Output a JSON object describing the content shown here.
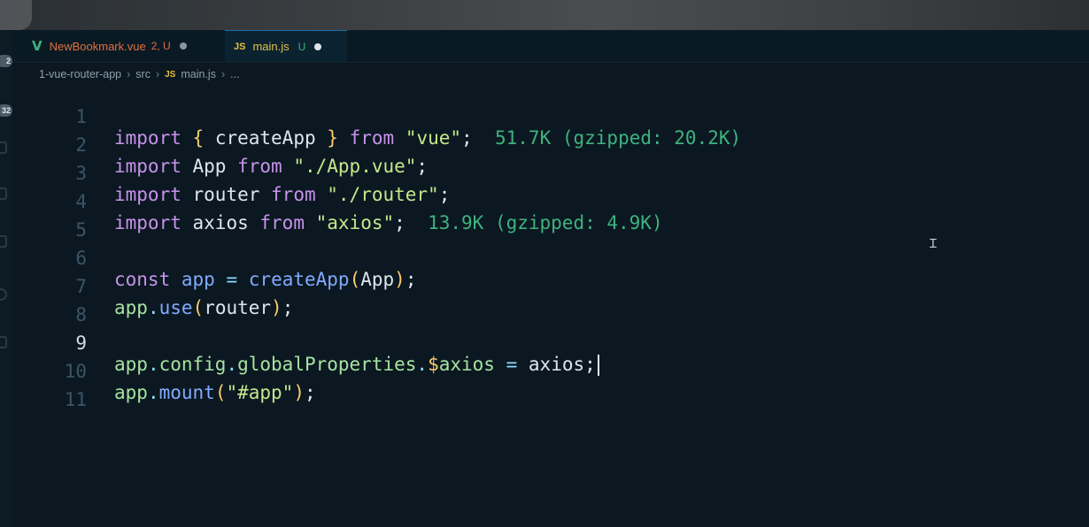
{
  "activity_bar": {
    "badges": [
      "2",
      "32"
    ]
  },
  "tabs": [
    {
      "filename": "NewBookmark.vue",
      "status": "2, U",
      "icon": "vue-icon",
      "icon_text": "V"
    },
    {
      "filename": "main.js",
      "status": "U",
      "icon": "js-icon",
      "icon_text": "JS"
    }
  ],
  "breadcrumb": {
    "segments": [
      "1-vue-router-app",
      "src",
      "main.js",
      "..."
    ],
    "file_icon_text": "JS"
  },
  "editor": {
    "active_line": 9,
    "line_numbers": [
      "1",
      "2",
      "3",
      "4",
      "5",
      "6",
      "7",
      "8",
      "9",
      "10",
      "11"
    ],
    "lines": [
      {
        "import_kw": "import",
        "brace_open": "{",
        "name": "createApp",
        "brace_close": "}",
        "from_kw": "from",
        "module": "\"vue\"",
        "semi": ";",
        "size_hint": "51.7K (gzipped: 20.2K)"
      },
      {
        "import_kw": "import",
        "name": "App",
        "from_kw": "from",
        "module": "\"./App.vue\"",
        "semi": ";"
      },
      {
        "import_kw": "import",
        "name": "router",
        "from_kw": "from",
        "module": "\"./router\"",
        "semi": ";"
      },
      {
        "import_kw": "import",
        "name": "axios",
        "from_kw": "from",
        "module": "\"axios\"",
        "semi": ";",
        "size_hint": "13.9K (gzipped: 4.9K)"
      },
      {},
      {
        "const_kw": "const",
        "var": "app",
        "eq": "=",
        "fn": "createApp",
        "paren_open": "(",
        "arg": "App",
        "paren_close": ")",
        "semi": ";"
      },
      {
        "obj": "app",
        "dot": ".",
        "fn": "use",
        "paren_open": "(",
        "arg": "router",
        "paren_close": ")",
        "semi": ";"
      },
      {},
      {
        "obj": "app",
        "dot1": ".",
        "p1": "config",
        "dot2": ".",
        "p2": "globalProperties",
        "dot3": ".",
        "sigil": "$",
        "p3": "axios",
        "eq": "=",
        "value": "axios",
        "semi": ";"
      },
      {
        "obj": "app",
        "dot": ".",
        "fn": "mount",
        "paren_open": "(",
        "arg": "\"#app\"",
        "paren_close": ")",
        "semi": ";"
      },
      {}
    ]
  },
  "colors": {
    "background": "#0b1821",
    "keyword": "#c792ea",
    "string": "#c3e88d",
    "function": "#82aaff",
    "size_hint": "#3fb27f",
    "vue_tab": "#e0703f",
    "js_tab": "#e2c24a"
  }
}
